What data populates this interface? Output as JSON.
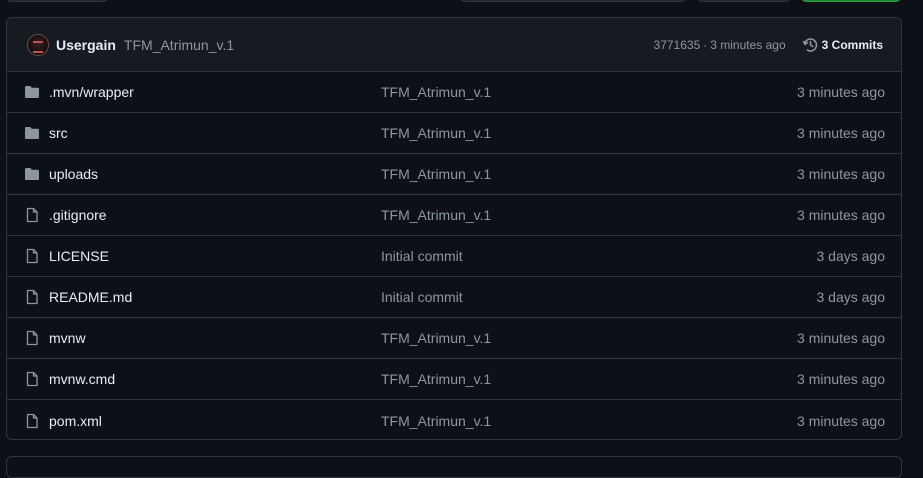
{
  "header": {
    "author": "Usergain",
    "commit_message": "TFM_Atrimun_v.1",
    "commit_hash": "3771635",
    "separator": "·",
    "commit_time": "3 minutes ago",
    "commits_label": "3 Commits"
  },
  "files": [
    {
      "name": ".mvn/wrapper",
      "type": "folder",
      "message": "TFM_Atrimun_v.1",
      "age": "3 minutes ago"
    },
    {
      "name": "src",
      "type": "folder",
      "message": "TFM_Atrimun_v.1",
      "age": "3 minutes ago"
    },
    {
      "name": "uploads",
      "type": "folder",
      "message": "TFM_Atrimun_v.1",
      "age": "3 minutes ago"
    },
    {
      "name": ".gitignore",
      "type": "file",
      "message": "TFM_Atrimun_v.1",
      "age": "3 minutes ago"
    },
    {
      "name": "LICENSE",
      "type": "file",
      "message": "Initial commit",
      "age": "3 days ago"
    },
    {
      "name": "README.md",
      "type": "file",
      "message": "Initial commit",
      "age": "3 days ago"
    },
    {
      "name": "mvnw",
      "type": "file",
      "message": "TFM_Atrimun_v.1",
      "age": "3 minutes ago"
    },
    {
      "name": "mvnw.cmd",
      "type": "file",
      "message": "TFM_Atrimun_v.1",
      "age": "3 minutes ago"
    },
    {
      "name": "pom.xml",
      "type": "file",
      "message": "TFM_Atrimun_v.1",
      "age": "3 minutes ago"
    }
  ],
  "colors": {
    "background": "#0d1117",
    "header_background": "#161b22",
    "border": "#30363d",
    "text": "#e6edf3",
    "muted_text": "#8d96a0",
    "icon": "#8d96a0",
    "accent_button": "#238636"
  }
}
